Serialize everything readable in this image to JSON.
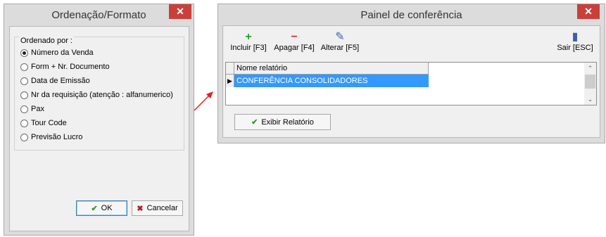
{
  "left_dialog": {
    "title": "Ordenação/Formato",
    "close_glyph": "✕",
    "group_label": "Ordenado por :",
    "options": [
      {
        "label": "Número da Venda",
        "checked": true
      },
      {
        "label": "Form + Nr. Documento",
        "checked": false
      },
      {
        "label": "Data de Emissão",
        "checked": false
      },
      {
        "label": "Nr da requisição (atenção : alfanumerico)",
        "checked": false
      },
      {
        "label": "Pax",
        "checked": false
      },
      {
        "label": "Tour Code",
        "checked": false
      },
      {
        "label": "Previsão Lucro",
        "checked": false
      }
    ],
    "ok_label": "OK",
    "cancel_label": "Cancelar"
  },
  "right_dialog": {
    "title": "Painel de conferência",
    "close_glyph": "✕",
    "toolbar": {
      "add_label": "Incluir [F3]",
      "delete_label": "Apagar [F4]",
      "edit_label": "Alterar [F5]",
      "exit_label": "Sair [ESC]"
    },
    "grid": {
      "column_header": "Nome relatório",
      "rows": [
        "CONFERÊNCIA CONSOLIDADORES"
      ]
    },
    "show_report_label": "Exibir Relatório"
  },
  "colors": {
    "close_button": "#c9403b",
    "selection": "#3399ff",
    "arrow": "#e02020",
    "add_icon": "#2aa02a",
    "delete_icon": "#d03030"
  }
}
